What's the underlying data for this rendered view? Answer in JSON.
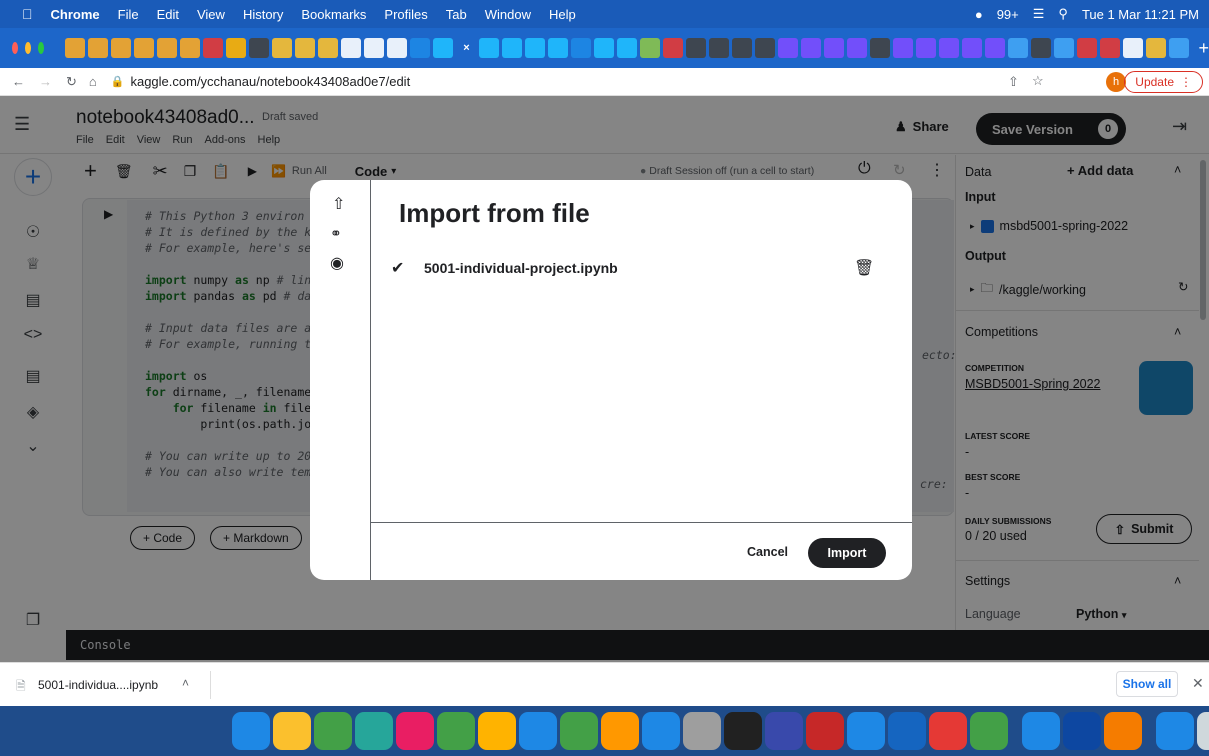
{
  "menubar": {
    "app": "Chrome",
    "items": [
      "File",
      "Edit",
      "View",
      "History",
      "Bookmarks",
      "Profiles",
      "Tab",
      "Window",
      "Help"
    ],
    "status": {
      "notifications": "99+",
      "datetime": "Tue 1 Mar  11:21 PM"
    }
  },
  "browser": {
    "url": "kaggle.com/ycchanau/notebook43408ad0e7/edit",
    "update_label": "Update",
    "profile_initial": "h"
  },
  "notebook": {
    "title": "notebook43408ad0...",
    "status": "Draft saved",
    "menus": [
      "File",
      "Edit",
      "View",
      "Run",
      "Add-ons",
      "Help"
    ],
    "share_label": "Share",
    "save_version_label": "Save Version",
    "save_version_count": "0",
    "run_all_label": "Run All",
    "cell_type": "Code",
    "session_status": "Draft Session off (run a cell to start)",
    "add_code_label": "+ Code",
    "add_markdown_label": "+ Markdown",
    "console_label": "Console",
    "code_lines": [
      {
        "cls": "cm",
        "text": "# This Python 3 environ"
      },
      {
        "cls": "cm",
        "text": "# It is defined by the k"
      },
      {
        "cls": "cm",
        "text": "# For example, here's se"
      },
      {
        "cls": "",
        "text": ""
      },
      {
        "cls": "mix",
        "kw": "import",
        "rest": " numpy ",
        "kw2": "as",
        "rest2": " np ",
        "cm": "# lin"
      },
      {
        "cls": "mix",
        "kw": "import",
        "rest": " pandas ",
        "kw2": "as",
        "rest2": " pd ",
        "cm": "# da"
      },
      {
        "cls": "",
        "text": ""
      },
      {
        "cls": "cm",
        "text": "# Input data files are a"
      },
      {
        "cls": "cm",
        "text": "# For example, running t"
      },
      {
        "cls": "",
        "text": ""
      },
      {
        "cls": "mix",
        "kw": "import",
        "rest": " os",
        "kw2": "",
        "rest2": "",
        "cm": ""
      },
      {
        "cls": "mix",
        "kw": "for",
        "rest": " dirname, _, filename",
        "kw2": "",
        "rest2": "",
        "cm": ""
      },
      {
        "cls": "mix",
        "kw": "    for",
        "rest": " filename ",
        "kw2": "in",
        "rest2": " file",
        "cm": ""
      },
      {
        "cls": "",
        "text": "        print(os.path.jo"
      },
      {
        "cls": "",
        "text": ""
      },
      {
        "cls": "cm",
        "text": "# You can write up to 20"
      },
      {
        "cls": "cm",
        "text": "# You can also write tem"
      }
    ],
    "code_right_fragments": [
      "ecto:",
      "cre:"
    ]
  },
  "right_panel": {
    "data_header": "Data",
    "add_data_label": "Add data",
    "input_label": "Input",
    "dataset_name": "msbd5001-spring-2022",
    "output_label": "Output",
    "output_path": "/kaggle/working",
    "competitions_header": "Competitions",
    "competition_label": "COMPETITION",
    "competition_name": "MSBD5001-Spring 2022",
    "latest_score_label": "LATEST SCORE",
    "latest_score": "-",
    "best_score_label": "BEST SCORE",
    "best_score": "-",
    "daily_submissions_label": "DAILY SUBMISSIONS",
    "daily_submissions": "0 / 20 used",
    "submit_label": "Submit",
    "settings_header": "Settings",
    "language_label": "Language",
    "language_value": "Python"
  },
  "modal": {
    "title": "Import from file",
    "file_name": "5001-individual-project.ipynb",
    "cancel_label": "Cancel",
    "import_label": "Import"
  },
  "download_bar": {
    "file_label": "5001-individua....ipynb",
    "show_all_label": "Show all"
  },
  "colors": {
    "menubar": "#1a5bb8",
    "tabstrip": "#1d66c9",
    "accent": "#1a73e8",
    "dark_button": "#202124",
    "competition_thumb": "#1e88c8"
  }
}
